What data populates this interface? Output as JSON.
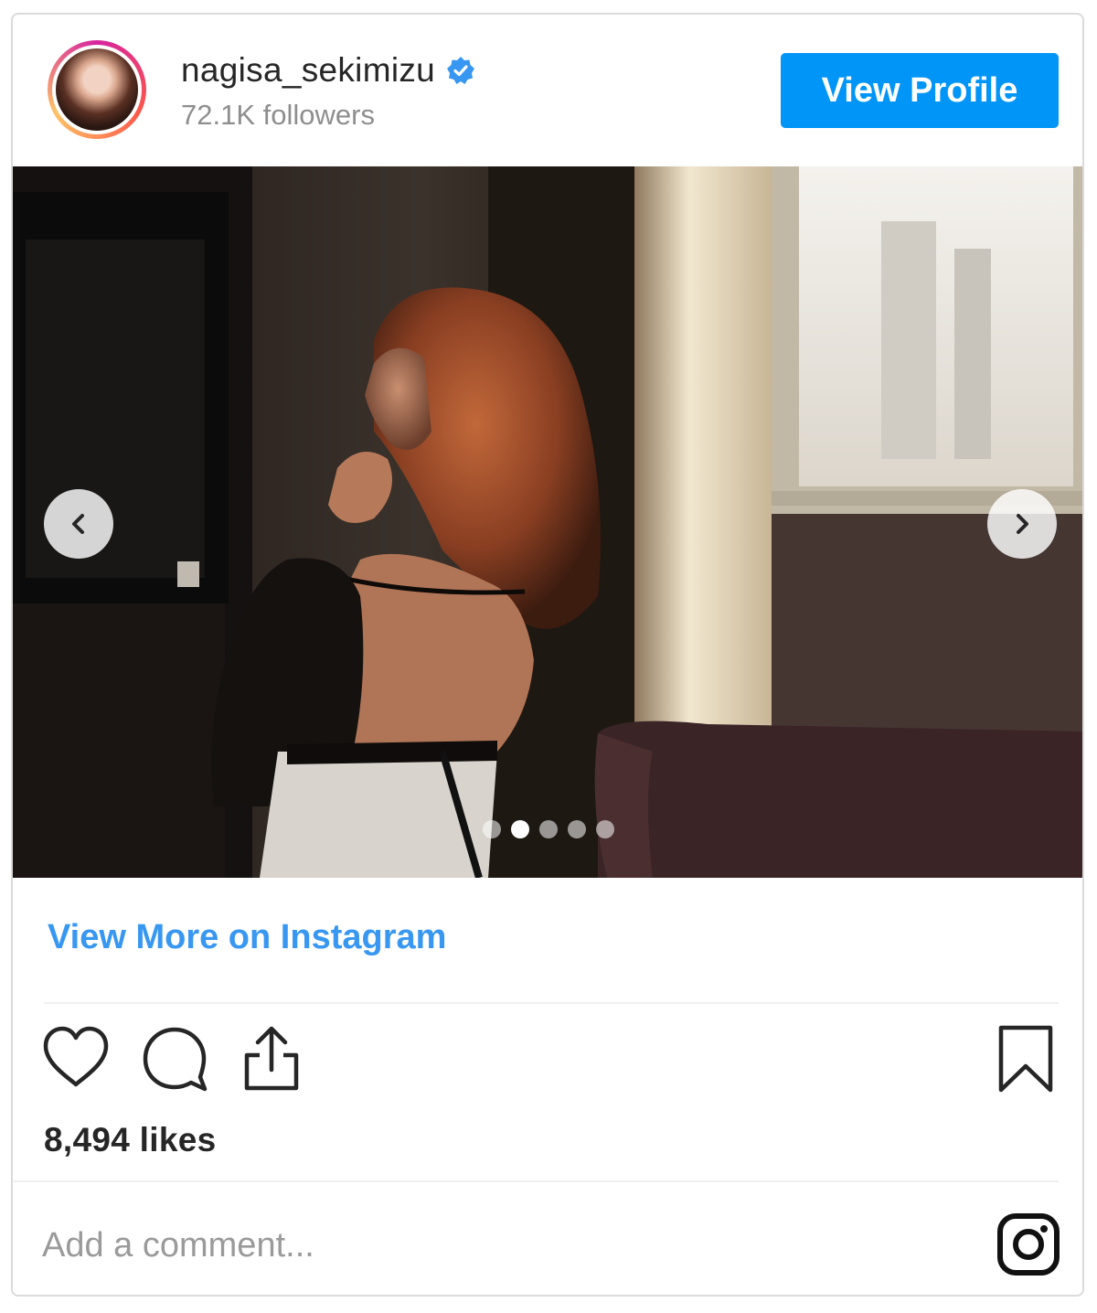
{
  "post": {
    "username": "nagisa_sekimizu",
    "followers": "72.1K followers",
    "view_profile_label": "View Profile",
    "view_more_label": "View More on Instagram",
    "likes": "8,494 likes",
    "comment_placeholder": "Add a comment...",
    "carousel": {
      "slide_count": 5,
      "active_index": 1
    }
  },
  "icons": {
    "verified": "verified-badge-icon",
    "prev": "chevron-left-icon",
    "next": "chevron-right-icon",
    "like": "heart-icon",
    "comment": "comment-bubble-icon",
    "share": "share-icon",
    "save": "bookmark-icon",
    "brand": "instagram-logo-icon"
  },
  "colors": {
    "accent": "#0095f6",
    "link": "#3897f0",
    "verified": "#3897f0",
    "text": "#262626",
    "muted": "#8e8e8e"
  }
}
